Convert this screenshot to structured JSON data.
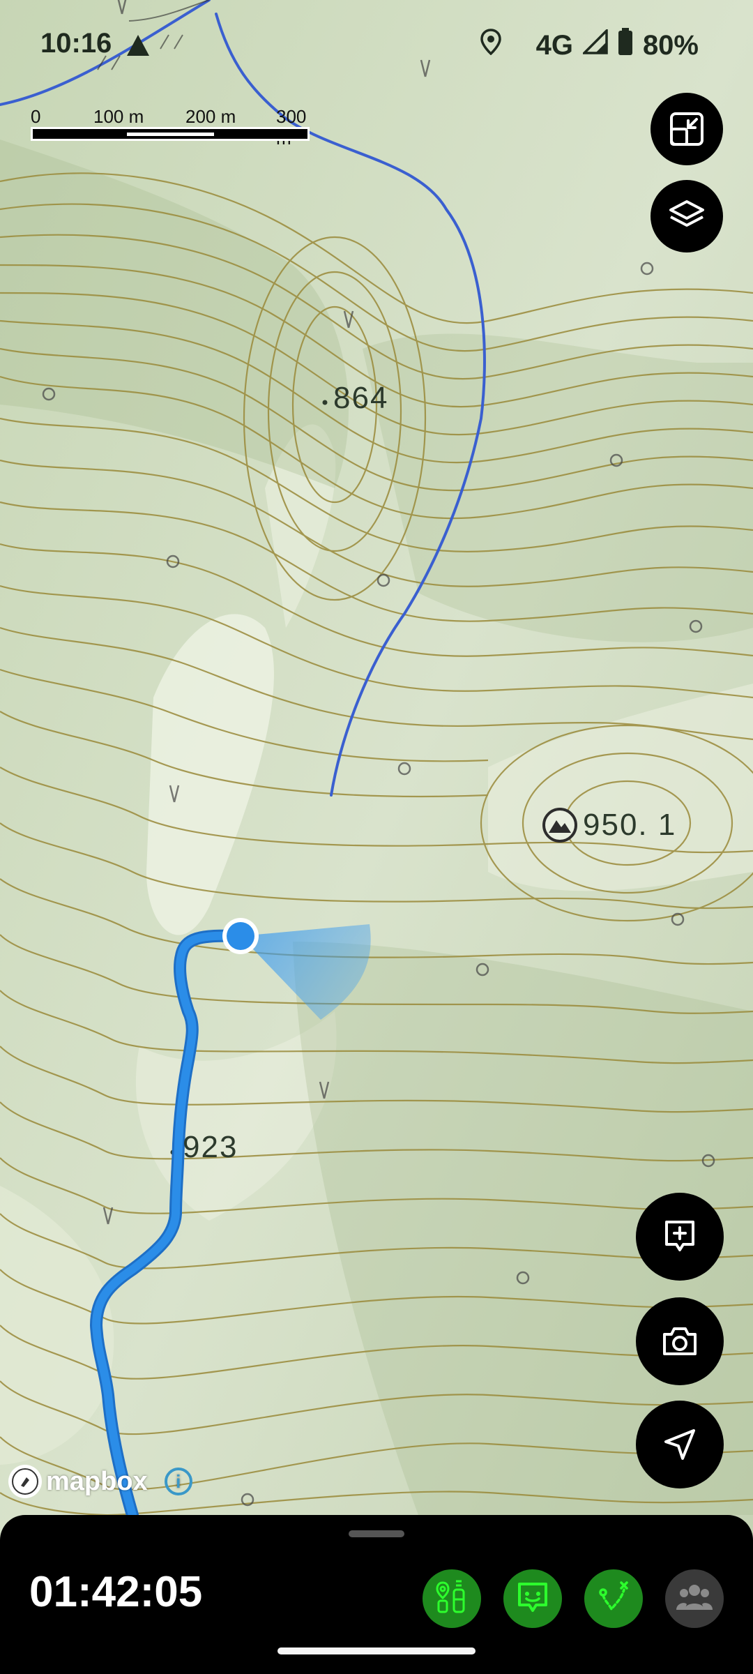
{
  "status_bar": {
    "time": "10:16",
    "network": "4G",
    "battery": "80%"
  },
  "scale_bar": {
    "ticks": [
      "0",
      "100 m",
      "200 m",
      "300 m"
    ]
  },
  "map": {
    "peak_label": "950. 1",
    "elevation_labels": [
      "864",
      "923"
    ],
    "attribution": "mapbox",
    "info_symbol": "i"
  },
  "controls": {
    "fullscreen_icon": "exit-fullscreen-icon",
    "layers_icon": "layers-icon",
    "add_note_icon": "add-note-icon",
    "camera_icon": "camera-icon",
    "locate_icon": "navigate-arrow-icon"
  },
  "bottom_sheet": {
    "elapsed_time": "01:42:05",
    "actions": [
      {
        "name": "gear-checklist",
        "color": "#1e8a1e"
      },
      {
        "name": "message",
        "color": "#1e8a1e"
      },
      {
        "name": "route-plan",
        "color": "#1e8a1e"
      },
      {
        "name": "group",
        "color": "#3a3a3a"
      }
    ]
  },
  "colors": {
    "track": "#2b8de8",
    "stream": "#3a5fd0",
    "contour": "#9a8a3a",
    "accent_green": "#22cc22"
  }
}
